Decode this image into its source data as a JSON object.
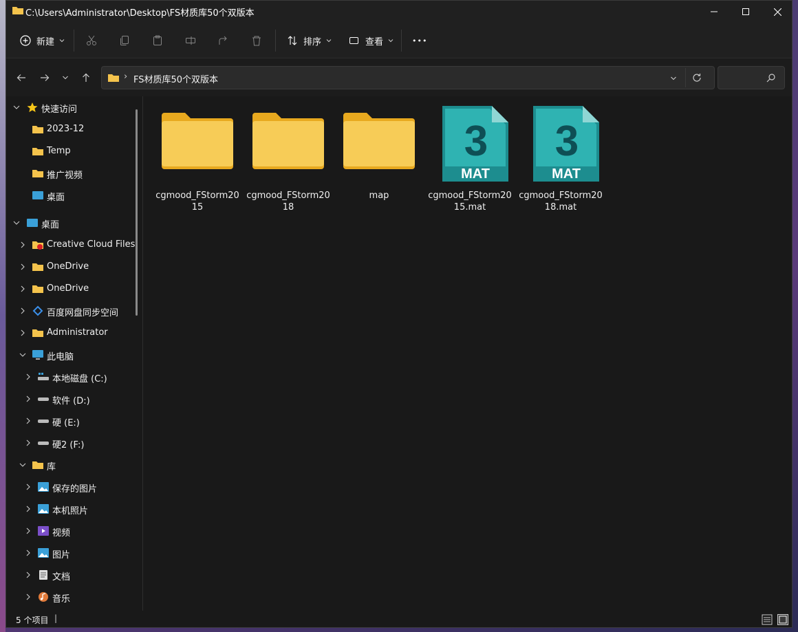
{
  "window": {
    "title": "C:\\Users\\Administrator\\Desktop\\FS材质库50个双版本"
  },
  "toolbar": {
    "new_label": "新建",
    "sort_label": "排序",
    "view_label": "查看",
    "more_label": "•••"
  },
  "address": {
    "current_folder": "FS材质库50个双版本",
    "separator": "›"
  },
  "sidebar": {
    "quick_access": "快速访问",
    "items": [
      {
        "label": "2023-12",
        "icon": "folder-icon"
      },
      {
        "label": "Temp",
        "icon": "folder-icon"
      },
      {
        "label": "推广视频",
        "icon": "folder-icon"
      },
      {
        "label": "桌面",
        "icon": "desktop-icon"
      },
      {
        "label": "桌面",
        "icon": "desktop-icon"
      },
      {
        "label": "Creative Cloud Files",
        "icon": "creative-cloud-icon"
      },
      {
        "label": "OneDrive",
        "icon": "folder-icon"
      },
      {
        "label": "OneDrive",
        "icon": "folder-icon"
      },
      {
        "label": "百度网盘同步空间",
        "icon": "baidu-netdisk-icon"
      },
      {
        "label": "Administrator",
        "icon": "folder-icon"
      },
      {
        "label": "此电脑",
        "icon": "computer-icon"
      },
      {
        "label": "本地磁盘 (C:)",
        "icon": "drive-icon"
      },
      {
        "label": "软件 (D:)",
        "icon": "drive-icon"
      },
      {
        "label": "硬 (E:)",
        "icon": "drive-icon"
      },
      {
        "label": "硬2 (F:)",
        "icon": "drive-icon"
      },
      {
        "label": "库",
        "icon": "library-icon"
      },
      {
        "label": "保存的图片",
        "icon": "pictures-icon"
      },
      {
        "label": "本机照片",
        "icon": "pictures-icon"
      },
      {
        "label": "视频",
        "icon": "videos-icon"
      },
      {
        "label": "图片",
        "icon": "pictures-icon"
      },
      {
        "label": "文档",
        "icon": "documents-icon"
      },
      {
        "label": "音乐",
        "icon": "music-icon"
      }
    ]
  },
  "files": [
    {
      "name": "cgmood_FStorm2015",
      "type": "folder"
    },
    {
      "name": "cgmood_FStorm2018",
      "type": "folder"
    },
    {
      "name": "map",
      "type": "folder"
    },
    {
      "name": "cgmood_FStorm2015.mat",
      "type": "mat",
      "badge": "MAT"
    },
    {
      "name": "cgmood_FStorm2018.mat",
      "type": "mat",
      "badge": "MAT"
    }
  ],
  "status": {
    "item_count": "5 个项目",
    "divider": "|"
  },
  "colors": {
    "folder": "#f4c34c",
    "mat_teal": "#1d8d8f",
    "background": "#191919"
  }
}
